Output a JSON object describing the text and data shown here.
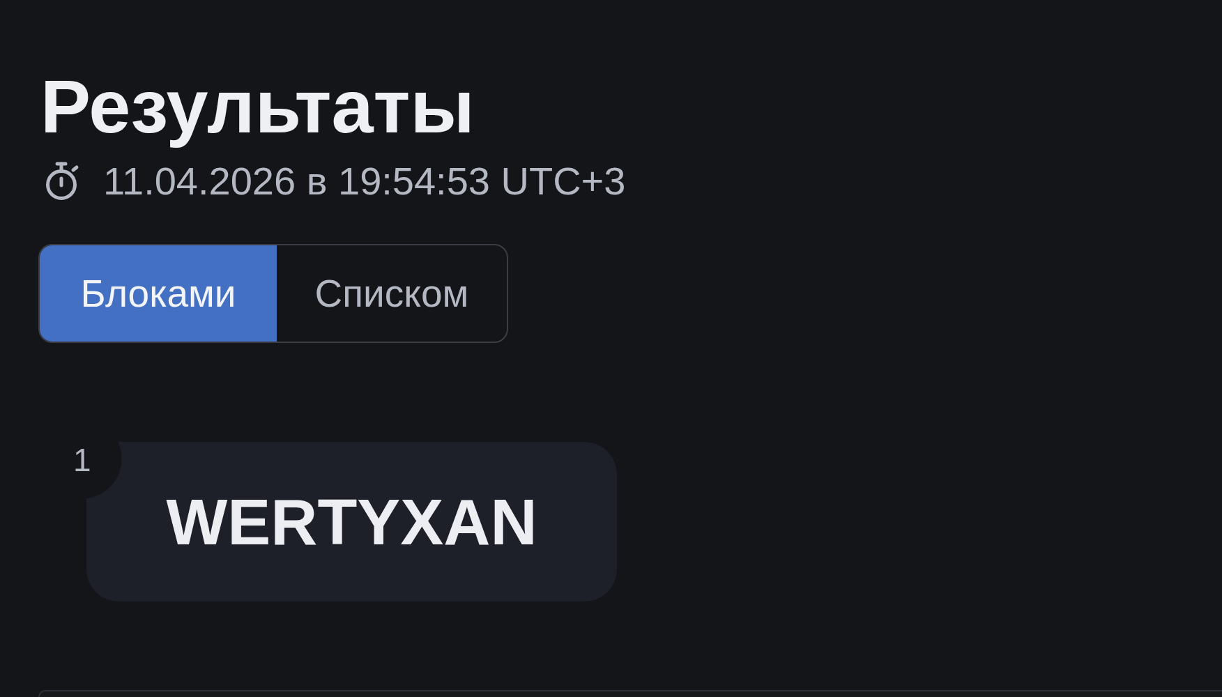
{
  "page": {
    "title": "Результаты",
    "timestamp": "11.04.2026 в 19:54:53 UTC+3"
  },
  "view_toggle": [
    {
      "label": "Блоками",
      "selected": true
    },
    {
      "label": "Списком",
      "selected": false
    }
  ],
  "results": [
    {
      "rank": "1",
      "name": "WERTYXAN"
    }
  ]
}
